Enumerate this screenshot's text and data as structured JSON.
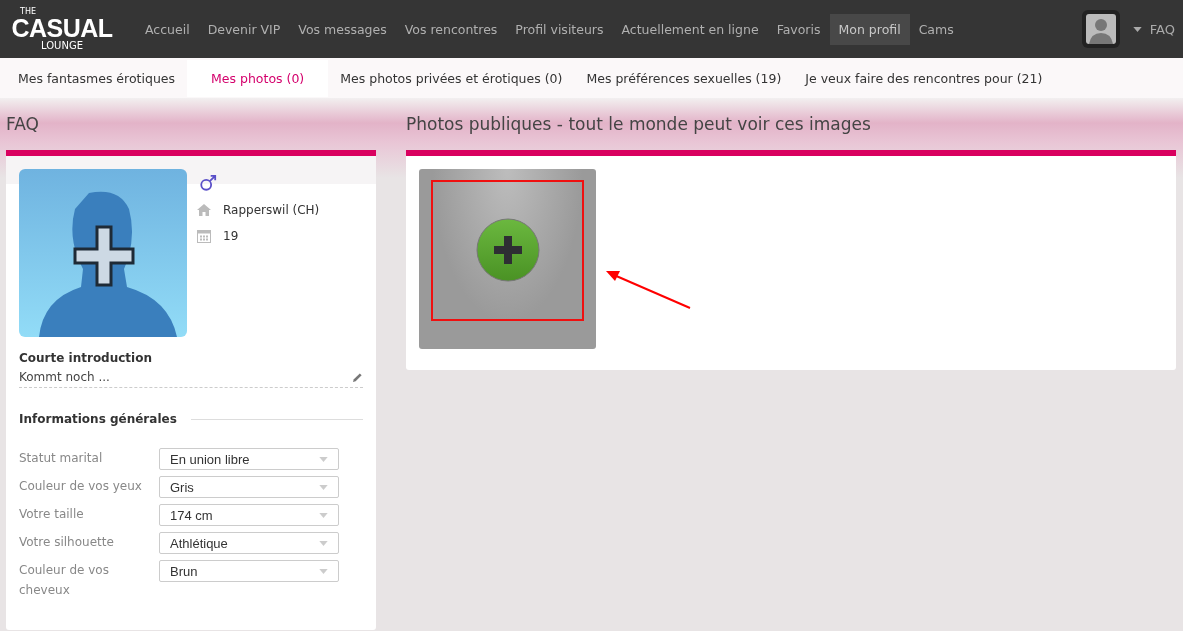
{
  "logo": {
    "top": "THE",
    "main": "CASUAL",
    "bottom": "LOUNGE"
  },
  "nav": [
    {
      "label": "Accueil",
      "selected": false
    },
    {
      "label": "Devenir VIP",
      "selected": false
    },
    {
      "label": "Vos messages",
      "selected": false
    },
    {
      "label": "Vos rencontres",
      "selected": false
    },
    {
      "label": "Profil visiteurs",
      "selected": false
    },
    {
      "label": "Actuellement en ligne",
      "selected": false
    },
    {
      "label": "Favoris",
      "selected": false
    },
    {
      "label": "Mon profil",
      "selected": true
    },
    {
      "label": "Cams",
      "selected": false
    }
  ],
  "user_menu": {
    "label": "FAQ"
  },
  "subtabs": [
    {
      "label": "Mes fantasmes érotiques",
      "selected": false
    },
    {
      "label": "Mes photos (0)",
      "selected": true
    },
    {
      "label": "Mes photos privées et érotiques (0)",
      "selected": false
    },
    {
      "label": "Mes préférences sexuelles (19)",
      "selected": false
    },
    {
      "label": "Je veux faire des rencontres pour (21)",
      "selected": false
    }
  ],
  "profile": {
    "title": "FAQ",
    "location": "Rapperswil (CH)",
    "age": "19",
    "intro": {
      "heading": "Courte introduction",
      "text": "Kommt noch ..."
    },
    "general": {
      "heading": "Informations générales",
      "fields": [
        {
          "label": "Statut marital",
          "value": "En union libre"
        },
        {
          "label": "Couleur de vos yeux",
          "value": "Gris"
        },
        {
          "label": "Votre taille",
          "value": "174 cm"
        },
        {
          "label": "Votre silhouette",
          "value": "Athlétique"
        },
        {
          "label": "Couleur de vos cheveux",
          "value": "Brun"
        }
      ]
    }
  },
  "photos": {
    "title": "Photos publiques - tout le monde peut voir ces images"
  }
}
